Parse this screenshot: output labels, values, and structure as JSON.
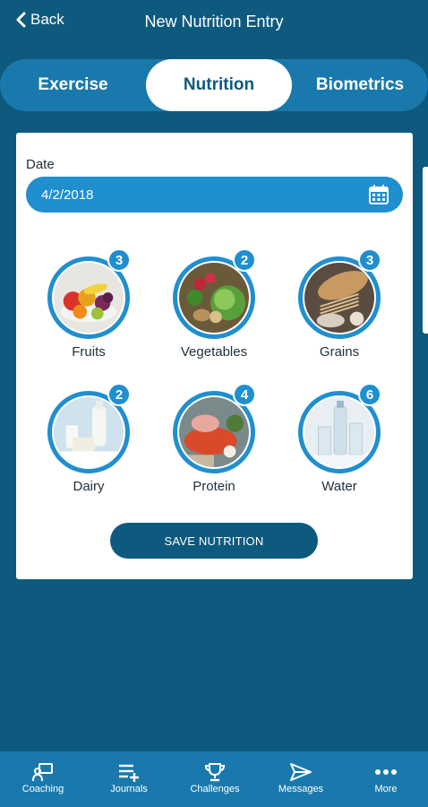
{
  "header": {
    "back_label": "Back",
    "title": "New Nutrition Entry"
  },
  "tabs": [
    {
      "label": "Exercise",
      "active": false
    },
    {
      "label": "Nutrition",
      "active": true
    },
    {
      "label": "Biometrics",
      "active": false
    }
  ],
  "form": {
    "date_label": "Date",
    "date_value": "4/2/2018"
  },
  "foods": [
    {
      "label": "Fruits",
      "count": "3"
    },
    {
      "label": "Vegetables",
      "count": "2"
    },
    {
      "label": "Grains",
      "count": "3"
    },
    {
      "label": "Dairy",
      "count": "2"
    },
    {
      "label": "Protein",
      "count": "4"
    },
    {
      "label": "Water",
      "count": "6"
    }
  ],
  "save_label": "SAVE NUTRITION",
  "bottom_nav": [
    {
      "label": "Coaching",
      "icon": "coaching-icon"
    },
    {
      "label": "Journals",
      "icon": "journals-icon"
    },
    {
      "label": "Challenges",
      "icon": "trophy-icon"
    },
    {
      "label": "Messages",
      "icon": "send-icon"
    },
    {
      "label": "More",
      "icon": "more-icon"
    }
  ],
  "colors": {
    "background": "#0e5a7e",
    "accent": "#1f8fd0",
    "tab_bar": "#1a79ac"
  }
}
